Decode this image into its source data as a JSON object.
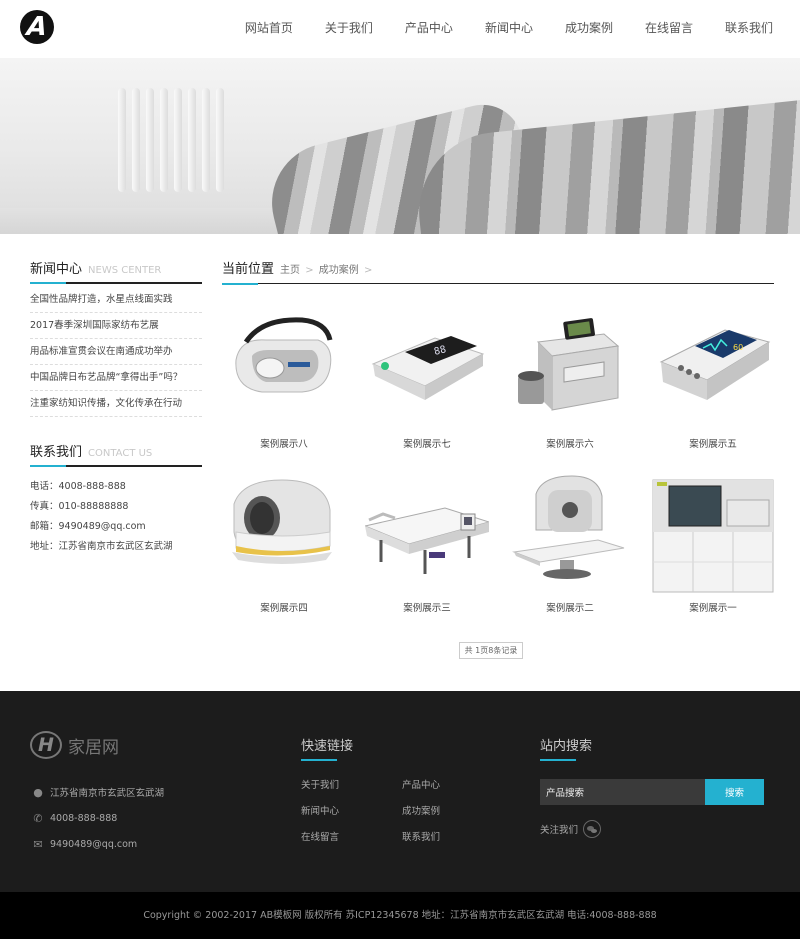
{
  "header": {
    "logo_letter": "A",
    "nav": [
      "网站首页",
      "关于我们",
      "产品中心",
      "新闻中心",
      "成功案例",
      "在线留言",
      "联系我们"
    ]
  },
  "sidebar": {
    "news": {
      "title": "新闻中心",
      "subtitle": "NEWS CENTER",
      "items": [
        "全国性品牌打造，水星点线面实践",
        "2017春季深圳国际家纺布艺展",
        "用品标准宣贯会议在南通成功举办",
        "中国品牌日布艺品牌“拿得出手”吗？",
        "注重家纺知识传播，文化传承在行动"
      ]
    },
    "contact": {
      "title": "联系我们",
      "subtitle": "CONTACT US",
      "items": [
        "电话：4008-888-888",
        "传真：010-88888888",
        "邮箱：9490489@qq.com",
        "地址：江苏省南京市玄武区玄武湖"
      ]
    }
  },
  "main": {
    "location_title": "当前位置",
    "breadcrumb": [
      "主页",
      "成功案例"
    ],
    "cases": [
      {
        "label": "案例展示八",
        "icon": "handheld-device-icon"
      },
      {
        "label": "案例展示七",
        "icon": "blood-pressure-monitor-icon"
      },
      {
        "label": "案例展示六",
        "icon": "lab-analyzer-icon"
      },
      {
        "label": "案例展示五",
        "icon": "patient-monitor-icon"
      },
      {
        "label": "案例展示四",
        "icon": "mri-scanner-icon"
      },
      {
        "label": "案例展示三",
        "icon": "hospital-bed-icon"
      },
      {
        "label": "案例展示二",
        "icon": "xray-scanner-icon"
      },
      {
        "label": "案例展示一",
        "icon": "analyzer-cabinet-icon"
      }
    ],
    "pager_text": "共 1页8条记录"
  },
  "footer": {
    "logo_letter": "H",
    "logo_text": "家居网",
    "address": "江苏省南京市玄武区玄武湖",
    "phone": "4008-888-888",
    "email": "9490489@qq.com",
    "quick_links_title": "快速链接",
    "quick_links": [
      "关于我们",
      "产品中心",
      "新闻中心",
      "成功案例",
      "在线留言",
      "联系我们"
    ],
    "search_title": "站内搜索",
    "search_value": "产品搜索",
    "search_button": "搜索",
    "follow_label": "关注我们",
    "copyright": "Copyright © 2002-2017 AB模板网 版权所有 苏ICP12345678  地址：江苏省南京市玄武区玄武湖  电话:4008-888-888"
  },
  "colors": {
    "accent": "#24b1d0",
    "footer_bg": "#1c1c1c",
    "copyright_bg": "#000000"
  }
}
